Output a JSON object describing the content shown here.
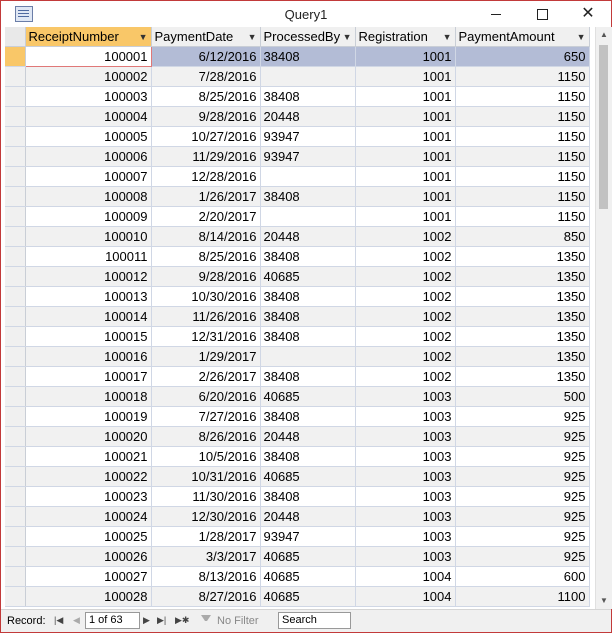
{
  "window": {
    "title": "Query1"
  },
  "columns": [
    "ReceiptNumber",
    "PaymentDate",
    "ProcessedBy",
    "Registration",
    "PaymentAmount"
  ],
  "rows": [
    [
      "100001",
      "6/12/2016",
      "38408",
      "1001",
      "650"
    ],
    [
      "100002",
      "7/28/2016",
      "",
      "1001",
      "1150"
    ],
    [
      "100003",
      "8/25/2016",
      "38408",
      "1001",
      "1150"
    ],
    [
      "100004",
      "9/28/2016",
      "20448",
      "1001",
      "1150"
    ],
    [
      "100005",
      "10/27/2016",
      "93947",
      "1001",
      "1150"
    ],
    [
      "100006",
      "11/29/2016",
      "93947",
      "1001",
      "1150"
    ],
    [
      "100007",
      "12/28/2016",
      "",
      "1001",
      "1150"
    ],
    [
      "100008",
      "1/26/2017",
      "38408",
      "1001",
      "1150"
    ],
    [
      "100009",
      "2/20/2017",
      "",
      "1001",
      "1150"
    ],
    [
      "100010",
      "8/14/2016",
      "20448",
      "1002",
      "850"
    ],
    [
      "100011",
      "8/25/2016",
      "38408",
      "1002",
      "1350"
    ],
    [
      "100012",
      "9/28/2016",
      "40685",
      "1002",
      "1350"
    ],
    [
      "100013",
      "10/30/2016",
      "38408",
      "1002",
      "1350"
    ],
    [
      "100014",
      "11/26/2016",
      "38408",
      "1002",
      "1350"
    ],
    [
      "100015",
      "12/31/2016",
      "38408",
      "1002",
      "1350"
    ],
    [
      "100016",
      "1/29/2017",
      "",
      "1002",
      "1350"
    ],
    [
      "100017",
      "2/26/2017",
      "38408",
      "1002",
      "1350"
    ],
    [
      "100018",
      "6/20/2016",
      "40685",
      "1003",
      "500"
    ],
    [
      "100019",
      "7/27/2016",
      "38408",
      "1003",
      "925"
    ],
    [
      "100020",
      "8/26/2016",
      "20448",
      "1003",
      "925"
    ],
    [
      "100021",
      "10/5/2016",
      "38408",
      "1003",
      "925"
    ],
    [
      "100022",
      "10/31/2016",
      "40685",
      "1003",
      "925"
    ],
    [
      "100023",
      "11/30/2016",
      "38408",
      "1003",
      "925"
    ],
    [
      "100024",
      "12/30/2016",
      "20448",
      "1003",
      "925"
    ],
    [
      "100025",
      "1/28/2017",
      "93947",
      "1003",
      "925"
    ],
    [
      "100026",
      "3/3/2017",
      "40685",
      "1003",
      "925"
    ],
    [
      "100027",
      "8/13/2016",
      "40685",
      "1004",
      "600"
    ],
    [
      "100028",
      "8/27/2016",
      "40685",
      "1004",
      "1100"
    ]
  ],
  "status": {
    "record_label": "Record:",
    "record_value": "1 of 63",
    "filter_label": "No Filter",
    "search_placeholder": "Search"
  }
}
